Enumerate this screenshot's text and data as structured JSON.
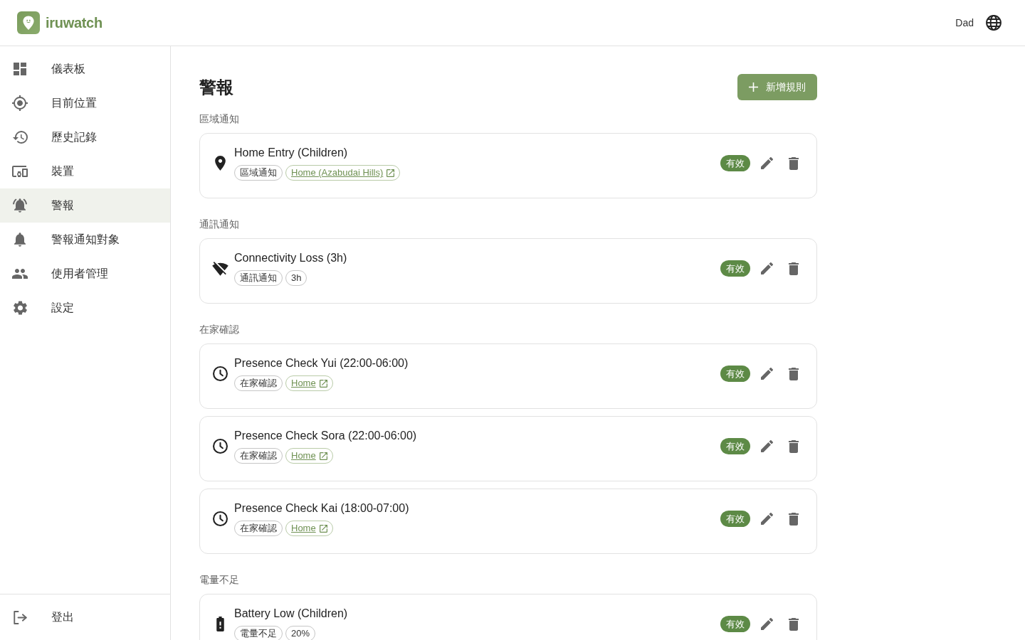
{
  "header": {
    "brand": "iruwatch",
    "user": "Dad"
  },
  "sidebar": {
    "items": [
      {
        "kind": "dashboard",
        "label": "儀表板",
        "selected": false
      },
      {
        "kind": "location",
        "label": "目前位置",
        "selected": false
      },
      {
        "kind": "history",
        "label": "歷史記錄",
        "selected": false
      },
      {
        "kind": "devices",
        "label": "裝置",
        "selected": false
      },
      {
        "kind": "alerts",
        "label": "警報",
        "selected": true
      },
      {
        "kind": "recipients",
        "label": "警報通知對象",
        "selected": false
      },
      {
        "kind": "users",
        "label": "使用者管理",
        "selected": false
      },
      {
        "kind": "settings",
        "label": "設定",
        "selected": false
      }
    ],
    "logout": {
      "label": "登出"
    }
  },
  "main": {
    "title": "警報",
    "add_button": {
      "label": "新增規則"
    },
    "sections": [
      {
        "title": "區域通知",
        "rules": [
          {
            "kind": "zone",
            "name": "Home Entry (Children)",
            "tags": [
              {
                "kind": "tag",
                "text": "區域通知"
              },
              {
                "kind": "link",
                "text": "Home (Azabudai Hills)"
              }
            ],
            "status": "有效",
            "enabled": true
          }
        ]
      },
      {
        "title": "通訊通知",
        "rules": [
          {
            "kind": "connectivity",
            "name": "Connectivity Loss (3h)",
            "tags": [
              {
                "kind": "tag",
                "text": "通訊通知"
              },
              {
                "kind": "tag",
                "text": "3h"
              }
            ],
            "status": "有效",
            "enabled": true
          }
        ]
      },
      {
        "title": "在家確認",
        "rules": [
          {
            "kind": "presence",
            "name": "Presence Check Yui (22:00-06:00)",
            "tags": [
              {
                "kind": "tag",
                "text": "在家確認"
              },
              {
                "kind": "link",
                "text": "Home"
              }
            ],
            "status": "有效",
            "enabled": true
          },
          {
            "kind": "presence",
            "name": "Presence Check Sora (22:00-06:00)",
            "tags": [
              {
                "kind": "tag",
                "text": "在家確認"
              },
              {
                "kind": "link",
                "text": "Home"
              }
            ],
            "status": "有效",
            "enabled": true
          },
          {
            "kind": "presence",
            "name": "Presence Check Kai (18:00-07:00)",
            "tags": [
              {
                "kind": "tag",
                "text": "在家確認"
              },
              {
                "kind": "link",
                "text": "Home"
              }
            ],
            "status": "有效",
            "enabled": true
          }
        ]
      },
      {
        "title": "電量不足",
        "rules": [
          {
            "kind": "battery",
            "name": "Battery Low (Children)",
            "tags": [
              {
                "kind": "tag",
                "text": "電量不足"
              },
              {
                "kind": "tag",
                "text": "20%"
              }
            ],
            "status": "有效",
            "enabled": true
          }
        ]
      }
    ]
  }
}
